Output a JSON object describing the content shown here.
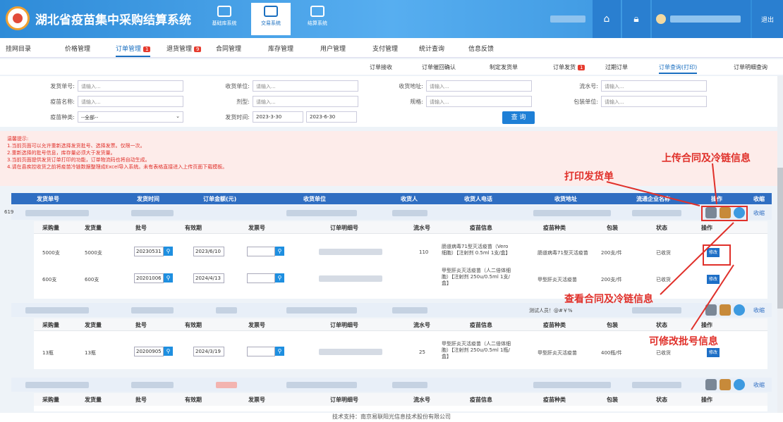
{
  "header": {
    "title": "湖北省疫苗集中采购结算系统",
    "nav": [
      {
        "label": "基础库系统"
      },
      {
        "label": "交易系统"
      },
      {
        "label": "结算系统"
      }
    ],
    "logout": "退出"
  },
  "menu": {
    "items": [
      {
        "label": "挂网目录"
      },
      {
        "label": "价格管理"
      },
      {
        "label": "订单管理",
        "badge": "1"
      },
      {
        "label": "退货管理",
        "badge": "9"
      },
      {
        "label": "合同管理"
      },
      {
        "label": "库存管理"
      },
      {
        "label": "用户管理"
      },
      {
        "label": "支付管理"
      },
      {
        "label": "统计查询"
      },
      {
        "label": "信息反馈"
      }
    ]
  },
  "subnav": {
    "items": [
      {
        "label": "订单接收"
      },
      {
        "label": "订单催回确认"
      },
      {
        "label": "制定发货单"
      },
      {
        "label": "订单发货",
        "badge": "1"
      },
      {
        "label": "过期订单"
      },
      {
        "label": "订单查询(打印)"
      },
      {
        "label": "订单明细查询"
      }
    ]
  },
  "filters": {
    "ship_no": {
      "label": "发货单号:",
      "placeholder": "请输入..."
    },
    "receiver_unit": {
      "label": "收货单位:",
      "placeholder": "请输入..."
    },
    "receive_addr": {
      "label": "收货地址:",
      "placeholder": "请输入..."
    },
    "serial_no": {
      "label": "流水号:",
      "placeholder": "请输入..."
    },
    "vaccine_name": {
      "label": "疫苗名称:",
      "placeholder": "请输入..."
    },
    "dosage_form": {
      "label": "剂型:",
      "placeholder": "请输入..."
    },
    "spec": {
      "label": "规格:",
      "placeholder": "请输入..."
    },
    "pack_unit": {
      "label": "包装单位:",
      "placeholder": "请输入..."
    },
    "vaccine_type": {
      "label": "疫苗种类:",
      "value": "--全部--"
    },
    "ship_time": {
      "label": "发货时间:",
      "from": "2023-3-30",
      "to": "2023-6-30"
    },
    "query_label": "查 询"
  },
  "tips": {
    "title": "温馨提示:",
    "lines": [
      "1.当前页面可以允许重新选择发货批号、选择发票。仅限一次。",
      "2.重新选择的批号信息，库存量必须大于发货量。",
      "3.当前页面提供发货订单打印的功能，订单物流码也将自动生成。",
      "4.请在县疾控收货之前将疫苗冷链数据整理成Excel导入系统。未有表格直接进入上传页面下载模板。"
    ]
  },
  "table": {
    "headers": [
      "发货单号",
      "发货时间",
      "订单金额(元)",
      "收货单位",
      "收货人",
      "收货人电话",
      "收货地址",
      "流通企业名称",
      "操作",
      "收缩"
    ]
  },
  "orders": [
    {
      "id_prefix": "619",
      "collapse": "收缩"
    },
    {
      "contact": "测试人员！@#￥%",
      "collapse": "收缩"
    },
    {
      "collapse": "收缩"
    }
  ],
  "detail_headers": [
    "采购量",
    "发货量",
    "批号",
    "有效期",
    "发票号",
    "订单明细号",
    "流水号",
    "疫苗信息",
    "疫苗种类",
    "包装",
    "状态",
    "操作"
  ],
  "details": [
    {
      "qty": "5000支",
      "ship": "5000支",
      "batch": "20230531",
      "expiry": "2023/6/10",
      "serial": "110",
      "info": "肠道病毒71型灭活疫苗（Vero细胞）【注射剂 0.5ml 1支/盒】",
      "type": "肠道病毒71型灭活疫苗",
      "pack": "200支/件",
      "status": "已收货",
      "op": "修改"
    },
    {
      "qty": "600支",
      "ship": "600支",
      "batch": "20201006",
      "expiry": "2024/4/13",
      "serial": "",
      "info": "甲型肝炎灭活疫苗（人二倍体细胞）【注射剂 250u/0.5ml 1支/盒】",
      "type": "甲型肝炎灭活疫苗",
      "pack": "200支/件",
      "status": "已收货",
      "op": "修改"
    },
    {
      "qty": "13瓶",
      "ship": "13瓶",
      "batch": "20200905",
      "expiry": "2024/3/19",
      "serial": "25",
      "info": "甲型肝炎灭活疫苗（人二倍体细胞）【注射剂 250u/0.5ml 1瓶/盒】",
      "type": "甲型肝炎灭活疫苗",
      "pack": "400瓶/件",
      "status": "已收货",
      "op": "修改"
    }
  ],
  "annotations": {
    "print": "打印发货单",
    "upload": "上传合同及冷链信息",
    "view": "查看合同及冷链信息",
    "edit": "可修改批号信息"
  },
  "footer": "技术支持：南京易联阳光信息技术股份有限公司"
}
